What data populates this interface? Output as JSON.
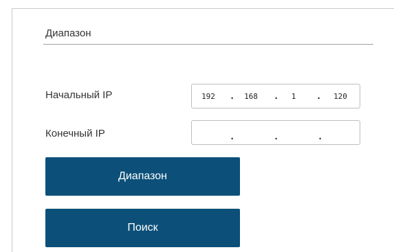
{
  "section": {
    "title": "Диапазон"
  },
  "start_ip": {
    "label": "Начальный IP",
    "octets": [
      "192",
      "168",
      "1",
      "120"
    ],
    "separator": "."
  },
  "end_ip": {
    "label": "Конечный IP",
    "octets": [
      "",
      "",
      "",
      ""
    ],
    "separator": "."
  },
  "buttons": {
    "range_label": "Диапазон",
    "search_label": "Поиск"
  },
  "colors": {
    "button_bg": "#0c5079",
    "button_text": "#ffffff",
    "text": "#333333",
    "border": "#bdbdbd"
  }
}
